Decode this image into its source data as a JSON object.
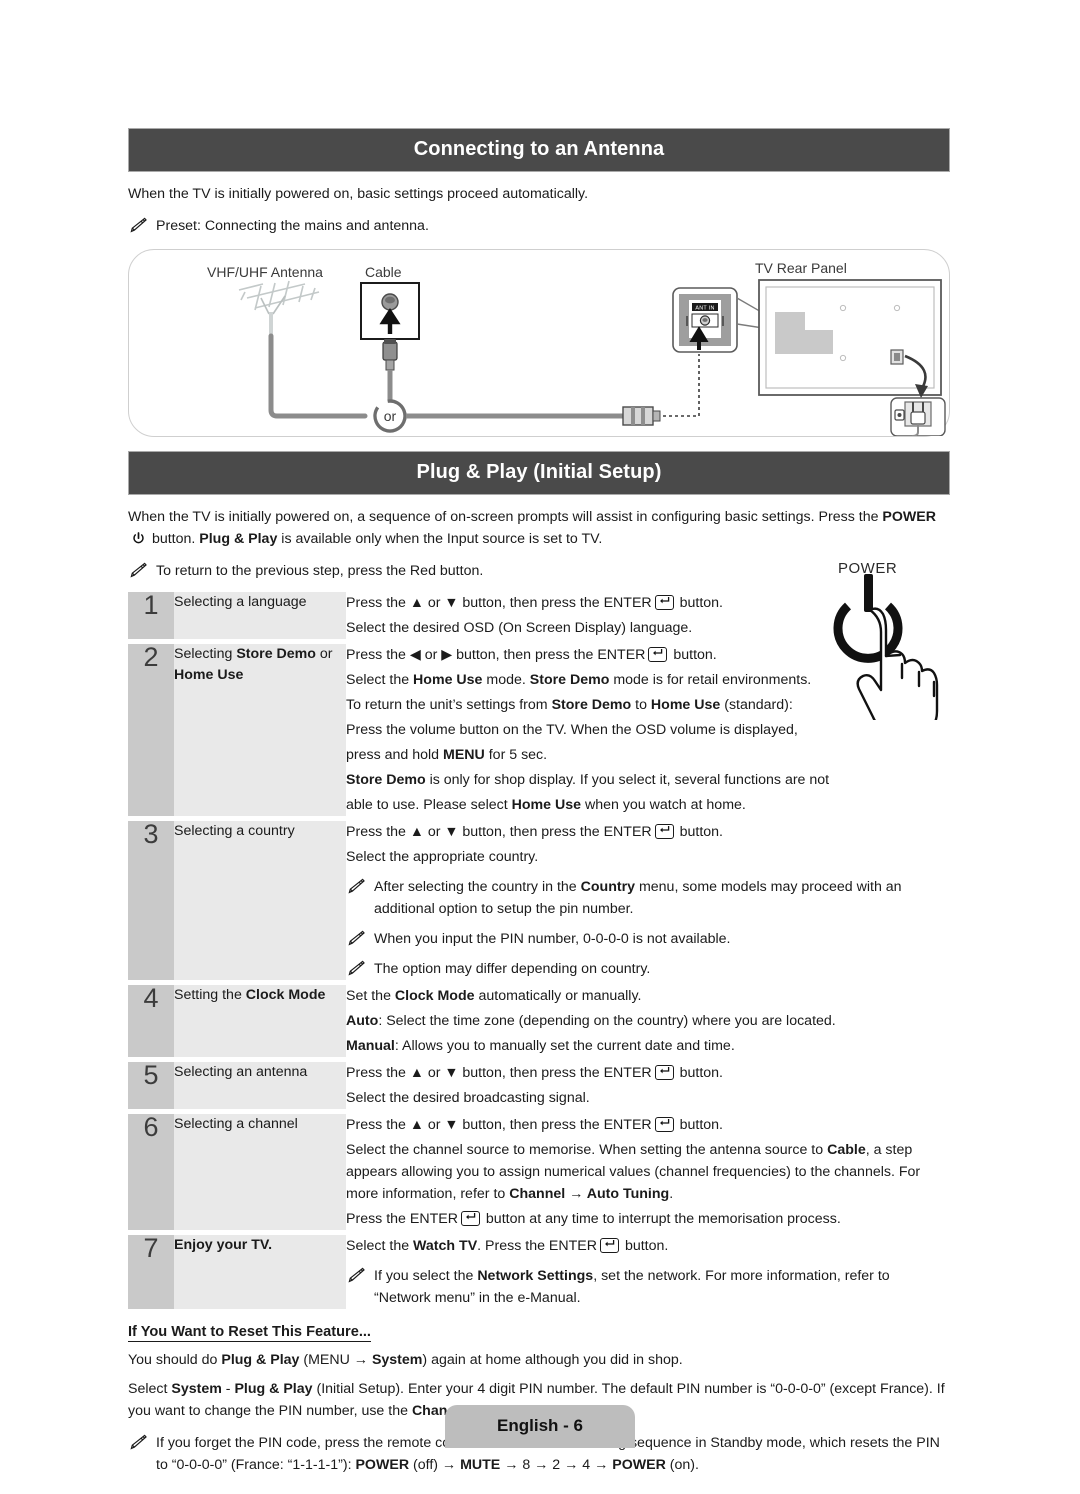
{
  "document": {
    "footer_label": "English - 6",
    "colors": {
      "header_bar": "#4a4a4a",
      "num_cell": "#c9c9c9",
      "label_cell": "#e9e9e9",
      "footer_tab": "#bdbdbd"
    }
  },
  "section_antenna": {
    "title": "Connecting to an Antenna",
    "intro": "When the TV is initially powered on, basic settings proceed automatically.",
    "note": "Preset: Connecting the mains and antenna.",
    "diagram": {
      "label_antenna": "VHF/UHF Antenna",
      "label_cable": "Cable",
      "label_tv": "TV Rear Panel",
      "label_or": "or",
      "label_ant_in": "ANT IN"
    }
  },
  "section_plugplay": {
    "title": "Plug & Play (Initial Setup)",
    "intro_line1_a": "When the TV is initially powered on, a sequence of on-screen prompts will assist in configuring basic settings. Press the ",
    "intro_power": "POWER",
    "intro_line2_a": " button. ",
    "intro_bold": "Plug & Play",
    "intro_line2_b": " is available only when the Input source is set to TV.",
    "note": "To return to the previous step, press the Red button.",
    "power_illustration_label": "POWER",
    "steps": [
      {
        "number": "1",
        "label_plain_1": "Selecting a language",
        "lines": [
          {
            "type": "enter",
            "pre": "Press the ▲ or ▼ button, then press the ENTER",
            "post": " button."
          },
          {
            "type": "text",
            "text": "Select the desired OSD (On Screen Display) language."
          }
        ]
      },
      {
        "number": "2",
        "label_plain_1": "Selecting ",
        "label_bold_1": "Store Demo",
        "label_plain_2": " or ",
        "label_bold_2": "Home Use",
        "lines": [
          {
            "type": "enter",
            "pre": "Press the ◀ or ▶ button, then press the ENTER",
            "post": " button."
          },
          {
            "type": "rich",
            "html": "Select the <b>Home Use</b> mode. <b>Store Demo</b> mode is for retail environments."
          },
          {
            "type": "rich",
            "html": "To return the unit’s settings from <b>Store Demo</b> to <b>Home Use</b> (standard):"
          },
          {
            "type": "rich",
            "html": "Press the volume button on the TV. When the OSD volume is displayed,"
          },
          {
            "type": "rich",
            "html": "press and hold <b>MENU</b> for 5 sec."
          },
          {
            "type": "rich",
            "html": "<b>Store Demo</b> is only for shop display. If you select it, several functions are not"
          },
          {
            "type": "rich",
            "html": "able to use. Please select <b>Home Use</b> when you watch at home."
          }
        ]
      },
      {
        "number": "3",
        "label_plain_1": "Selecting a country",
        "lines": [
          {
            "type": "enter",
            "pre": "Press the ▲ or ▼ button, then press the ENTER",
            "post": " button."
          },
          {
            "type": "text",
            "text": "Select the appropriate country."
          },
          {
            "type": "note",
            "html": "After selecting the country in the <b>Country</b> menu, some models may proceed with an additional option to setup the pin number."
          },
          {
            "type": "note",
            "html": "When you input the PIN number, 0-0-0-0 is not available."
          },
          {
            "type": "note",
            "html": "The option may differ depending on country."
          }
        ]
      },
      {
        "number": "4",
        "label_plain_1": "Setting the ",
        "label_bold_1": "Clock Mode",
        "lines": [
          {
            "type": "rich",
            "html": "Set the <b>Clock Mode</b> automatically or manually."
          },
          {
            "type": "rich",
            "html": "<b>Auto</b>: Select the time zone (depending on the country) where you are located."
          },
          {
            "type": "rich",
            "html": "<b>Manual</b>: Allows you to manually set the current date and time."
          }
        ]
      },
      {
        "number": "5",
        "label_plain_1": "Selecting an antenna",
        "lines": [
          {
            "type": "enter",
            "pre": "Press the ▲ or ▼ button, then press the ENTER",
            "post": " button."
          },
          {
            "type": "text",
            "text": "Select the desired broadcasting signal."
          }
        ]
      },
      {
        "number": "6",
        "label_plain_1": "Selecting a channel",
        "lines": [
          {
            "type": "enter",
            "pre": "Press the ▲ or ▼ button, then press the ENTER",
            "post": " button."
          },
          {
            "type": "rich",
            "html": "Select the channel source to memorise. When setting the antenna source to <b>Cable</b>, a step appears allowing you to assign numerical values (channel frequencies) to the channels. For more information, refer to <b>Channel → Auto Tuning</b>."
          },
          {
            "type": "enter",
            "pre": "Press the ENTER",
            "post": " button at any time to interrupt the memorisation process."
          }
        ]
      },
      {
        "number": "7",
        "label_bold_1": "Enjoy your TV.",
        "lines": [
          {
            "type": "enter",
            "pre": "Select the <b>Watch TV</b>. Press the ENTER",
            "post": " button."
          },
          {
            "type": "note",
            "html": "If you select the <b>Network Settings</b>, set the network. For more information, refer to “Network menu” in the e-Manual."
          }
        ]
      }
    ]
  },
  "section_reset": {
    "heading": "If You Want to Reset This Feature...",
    "para1": "You should do <b>Plug &amp; Play</b> (MENU → <b>System</b>) again at home although you did in shop.",
    "para2": "Select <b>System</b> - <b>Plug &amp; Play</b> (Initial Setup). Enter your 4 digit PIN number. The default PIN number is “0-0-0-0” (except France). If you want to change the PIN number, use the <b>Change PIN</b> function.",
    "note": "If you forget the PIN code, press the remote control buttons in the following sequence in Standby mode, which resets the PIN to “0-0-0-0” (France: “1-1-1-1”): <b>POWER</b> (off) → <b>MUTE</b> → 8 → 2 → 4 → <b>POWER</b> (on)."
  }
}
